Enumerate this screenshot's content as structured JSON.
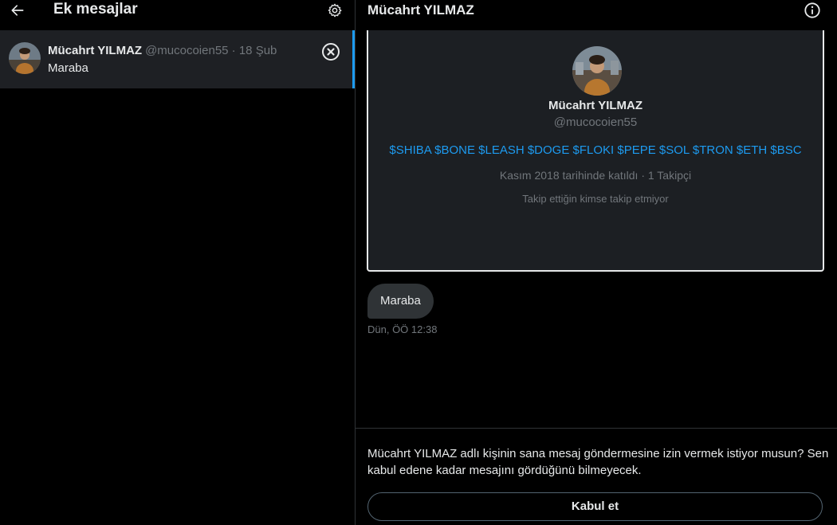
{
  "left": {
    "title": "Ek mesajlar",
    "conversation": {
      "name": "Mücahrt YILMAZ",
      "handle_date": "@mucocoien55 · 18 Şub",
      "preview": "Maraba"
    }
  },
  "right": {
    "title": "Mücahrt YILMAZ",
    "profile": {
      "name": "Mücahrt YILMAZ",
      "handle": "@mucocoien55",
      "bio": "$SHIBA $BONE $LEASH $DOGE $FLOKI $PEPE $SOL $TRON $ETH $BSC",
      "joined": "Kasım 2018 tarihinde katıldı · 1 Takipçi",
      "follow_note": "Takip ettiğin kimse takip etmiyor"
    },
    "message": {
      "text": "Maraba",
      "time": "Dün, ÖÖ 12:38"
    },
    "request": {
      "text": "Mücahrt YILMAZ adlı kişinin sana mesaj göndermesine izin vermek istiyor musun? Sen kabul edene kadar mesajını gördüğünü bilmeyecek.",
      "accept_label": "Kabul et"
    }
  },
  "colors": {
    "background": "#000000",
    "text": "#e7e9ea",
    "muted": "#71767b",
    "accent": "#1d9bf0",
    "card": "#1c1f23"
  },
  "icons": [
    "back-arrow-icon",
    "gear-icon",
    "close-circle-icon",
    "info-icon"
  ]
}
